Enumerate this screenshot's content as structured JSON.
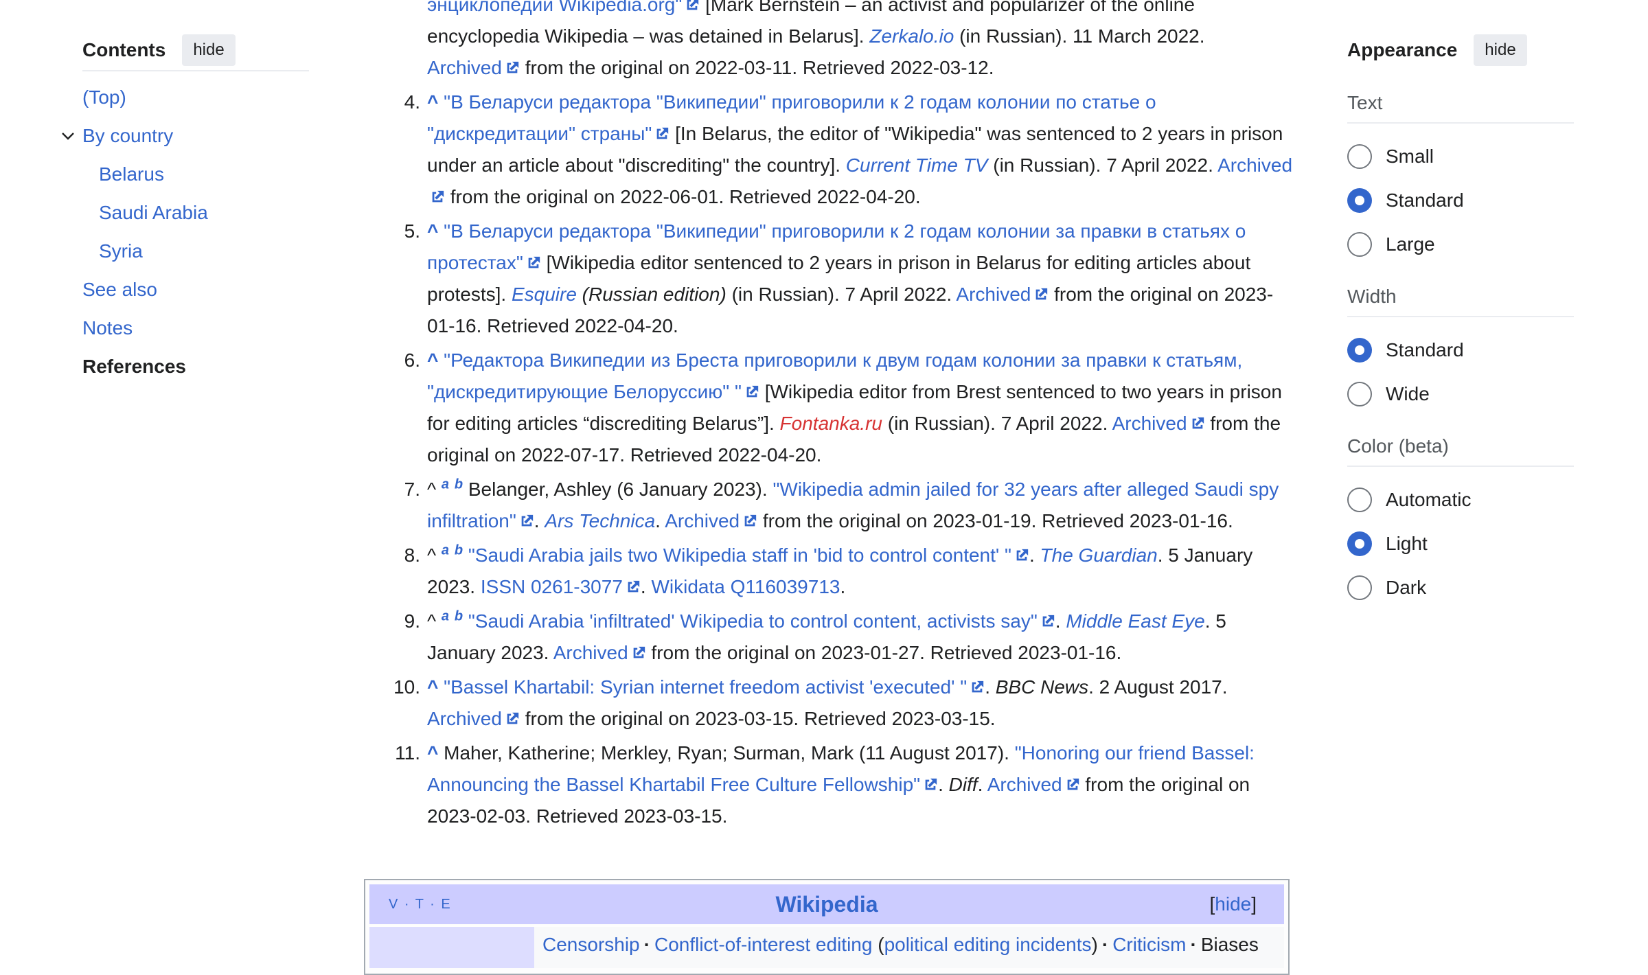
{
  "toc": {
    "title": "Contents",
    "hide_label": "hide",
    "items": [
      {
        "label": "(Top)"
      },
      {
        "label": "By country"
      },
      {
        "label": "Belarus"
      },
      {
        "label": "Saudi Arabia"
      },
      {
        "label": "Syria"
      },
      {
        "label": "See also"
      },
      {
        "label": "Notes"
      },
      {
        "label": "References"
      }
    ]
  },
  "appearance": {
    "title": "Appearance",
    "hide_label": "hide",
    "text": {
      "label": "Text",
      "options": [
        "Small",
        "Standard",
        "Large"
      ],
      "selected": "Standard"
    },
    "width": {
      "label": "Width",
      "options": [
        "Standard",
        "Wide"
      ],
      "selected": "Standard"
    },
    "color": {
      "label": "Color (beta)",
      "options": [
        "Automatic",
        "Light",
        "Dark"
      ],
      "selected": "Light"
    }
  },
  "refs": {
    "r3": {
      "l1": "энциклопедии Wikipedia.org\"",
      "l1b": "[Mark Bernstein – an activist and popularizer of the online",
      "l2": "encyclopedia Wikipedia – was detained in Belarus].",
      "src": "Zerkalo.io",
      "l2b": "(in Russian). 11 March 2022.",
      "arch": "Archived",
      "l3": "from the original on 2022-03-11. Retrieved 2022-03-12."
    },
    "r4": {
      "num": "4.",
      "caret": "^",
      "title": "\"В Беларуси редактора \"Википедии\" приговорили к 2 годам колонии по статье о \"дискредитации\" страны\"",
      "trans": "[In Belarus, the editor of \"Wikipedia\" was sentenced to 2 years in prison under an article about \"discrediting\" the country].",
      "src": "Current Time TV",
      "rest": "(in Russian). 7 April 2022.",
      "arch": "Archived",
      "tail": "from the original on 2022-06-01. Retrieved 2022-04-20."
    },
    "r5": {
      "num": "5.",
      "caret": "^",
      "title": "\"В Беларуси редактора \"Википедии\" приговорили к 2 годам колонии за правки в статьях о протестах\"",
      "trans": "[Wikipedia editor sentenced to 2 years in prison in Belarus for editing articles about protests].",
      "src": "Esquire",
      "edition": "(Russian edition)",
      "rest": "(in Russian). 7 April 2022.",
      "arch": "Archived",
      "tail": "from the original on 2023-01-16. Retrieved 2022-04-20."
    },
    "r6": {
      "num": "6.",
      "caret": "^",
      "title": "\"Редактора Википедии из Бреста приговорили к двум годам колонии за правки к статьям, \"дискредитирующие Белоруссию\" \"",
      "trans": "[Wikipedia editor from Brest sentenced to two years in prison for editing articles “discrediting Belarus”].",
      "src": "Fontanka.ru",
      "rest": "(in Russian). 7 April 2022.",
      "arch": "Archived",
      "tail": "from the original on 2022-07-17. Retrieved 2022-04-20."
    },
    "r7": {
      "num": "7.",
      "caret": "^",
      "sup_a": "a",
      "sup_b": "b",
      "author": "Belanger, Ashley (6 January 2023).",
      "title": "\"Wikipedia admin jailed for 32 years after alleged Saudi spy infiltration\"",
      "src": "Ars Technica",
      "arch": "Archived",
      "tail": "from the original on 2023-01-19. Retrieved 2023-01-16."
    },
    "r8": {
      "num": "8.",
      "caret": "^",
      "sup_a": "a",
      "sup_b": "b",
      "title": "\"Saudi Arabia jails two Wikipedia staff in 'bid to control content' \"",
      "src": "The Guardian",
      "date": ". 5 January 2023.",
      "issn": "ISSN 0261-3077",
      "wikidata": "Wikidata Q116039713"
    },
    "r9": {
      "num": "9.",
      "caret": "^",
      "sup_a": "a",
      "sup_b": "b",
      "title": "\"Saudi Arabia 'infiltrated' Wikipedia to control content, activists say\"",
      "src": "Middle East Eye",
      "date": ". 5 January 2023.",
      "arch": "Archived",
      "tail": "from the original on 2023-01-27. Retrieved 2023-01-16."
    },
    "r10": {
      "num": "10.",
      "caret": "^",
      "title": "\"Bassel Khartabil: Syrian internet freedom activist 'executed' \"",
      "src": "BBC News",
      "date": ". 2 August 2017.",
      "arch": "Archived",
      "tail": "from the original on 2023-03-15. Retrieved 2023-03-15."
    },
    "r11": {
      "num": "11.",
      "caret": "^",
      "author": "Maher, Katherine; Merkley, Ryan; Surman, Mark (11 August 2017).",
      "title": "\"Honoring our friend Bassel: Announcing the Bassel Khartabil Free Culture Fellowship\"",
      "src": "Diff",
      "arch": "Archived",
      "tail": "from the original on 2023-02-03. Retrieved 2023-03-15."
    }
  },
  "navbox": {
    "vte": "V · T · E",
    "title": "Wikipedia",
    "hide_label": "hide",
    "items": [
      "Censorship",
      "Conflict-of-interest editing",
      "political editing incidents",
      "Criticism",
      "Biases"
    ]
  },
  "colors": {
    "link": "#3366cc",
    "text": "#202122",
    "redlink": "#d73333",
    "navbox_title_bg": "#ccccff",
    "navbox_group_bg": "#ddddff"
  }
}
